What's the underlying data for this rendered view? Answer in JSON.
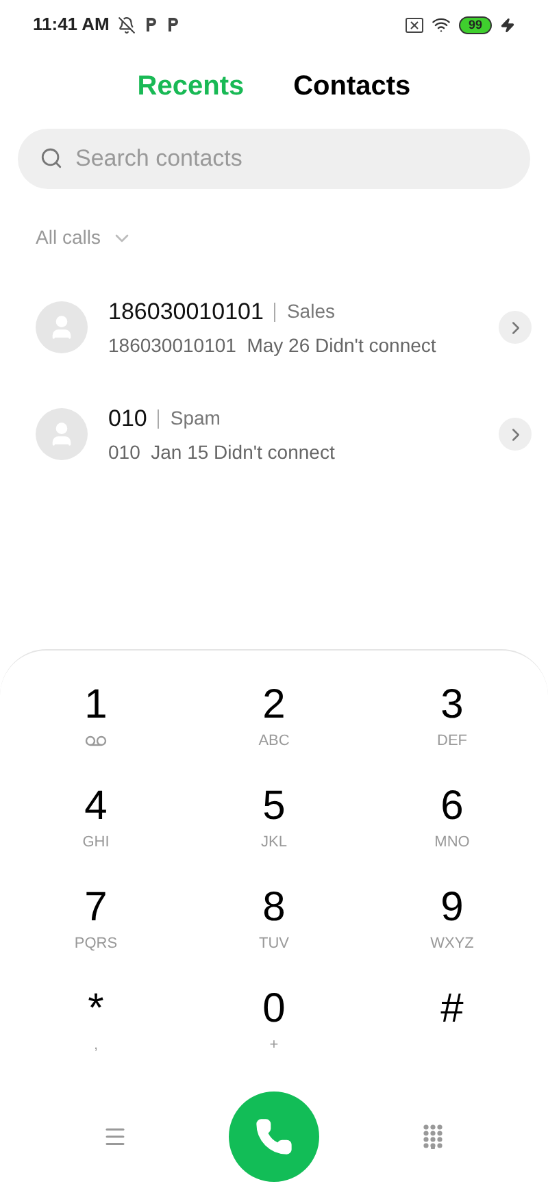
{
  "status_bar": {
    "time": "11:41 AM",
    "battery": "99"
  },
  "tabs": [
    {
      "label": "Recents",
      "selected": true
    },
    {
      "label": "Contacts",
      "selected": false
    }
  ],
  "search": {
    "placeholder": "Search contacts"
  },
  "filter": {
    "label": "All calls"
  },
  "calls": [
    {
      "number": "186030010101",
      "tag": "Sales",
      "detail": "186030010101  May 26 Didn't connect"
    },
    {
      "number": "010",
      "tag": "Spam",
      "detail": "010  Jan 15 Didn't connect"
    }
  ],
  "keypad": [
    {
      "digit": "1",
      "kind": "voicemail"
    },
    {
      "digit": "2",
      "letters": "ABC",
      "kind": "text"
    },
    {
      "digit": "3",
      "letters": "DEF",
      "kind": "text"
    },
    {
      "digit": "4",
      "letters": "GHI",
      "kind": "text"
    },
    {
      "digit": "5",
      "letters": "JKL",
      "kind": "text"
    },
    {
      "digit": "6",
      "letters": "MNO",
      "kind": "text"
    },
    {
      "digit": "7",
      "letters": "PQRS",
      "kind": "text"
    },
    {
      "digit": "8",
      "letters": "TUV",
      "kind": "text"
    },
    {
      "digit": "9",
      "letters": "WXYZ",
      "kind": "text"
    },
    {
      "digit": "*",
      "letters": ",",
      "kind": "text"
    },
    {
      "digit": "0",
      "letters": "+",
      "kind": "text"
    },
    {
      "digit": "#",
      "kind": "text"
    }
  ]
}
